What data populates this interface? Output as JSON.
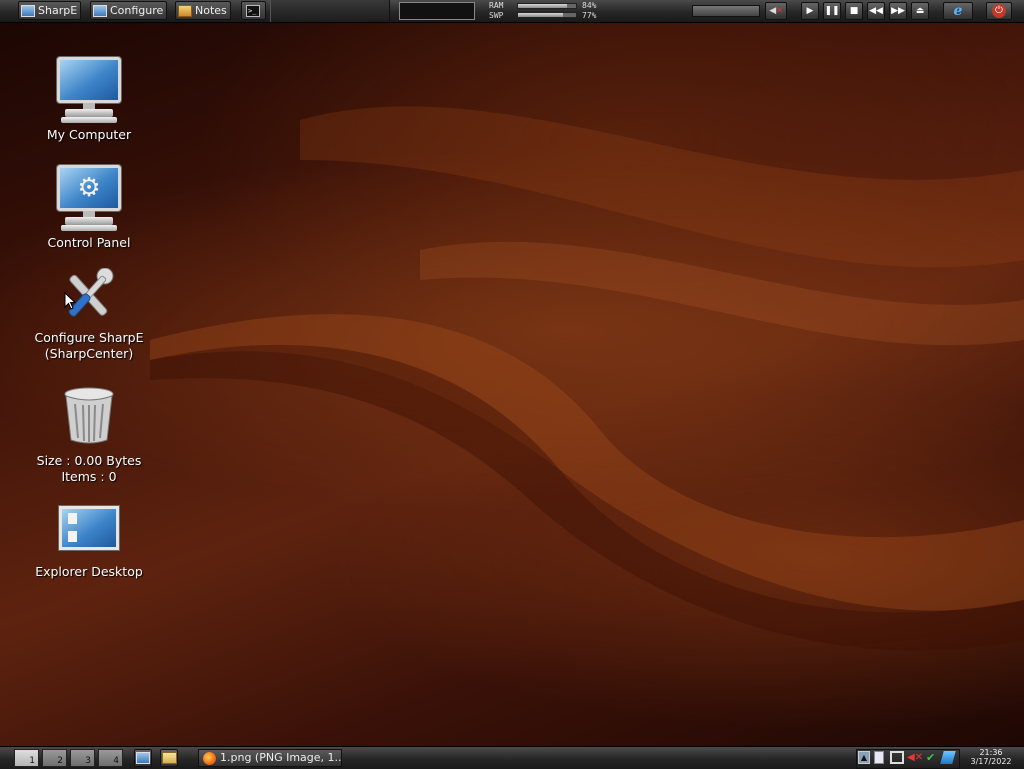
{
  "topbar": {
    "buttons": [
      {
        "label": "SharpE",
        "icon": "monitor-icon"
      },
      {
        "label": "Configure",
        "icon": "monitor-icon"
      },
      {
        "label": "Notes",
        "icon": "notes-icon"
      },
      {
        "label": "",
        "icon": "terminal-icon"
      }
    ],
    "meters": [
      {
        "label": "RAM",
        "percent_text": "84%",
        "value": 0.84
      },
      {
        "label": "SWP",
        "percent_text": "77%",
        "value": 0.77
      }
    ],
    "media_controls": [
      "play-icon",
      "pause-icon",
      "stop-icon",
      "previous-icon",
      "next-icon",
      "eject-icon"
    ],
    "volume_level": 0.5
  },
  "desktop": {
    "icons": [
      {
        "label": "My Computer",
        "icon": "computer-icon"
      },
      {
        "label": "Control Panel",
        "icon": "control-panel-icon"
      },
      {
        "label": "Configure SharpE\n(SharpCenter)",
        "icon": "tools-icon"
      },
      {
        "label": "Size : 0.00 Bytes\nItems : 0",
        "icon": "recycle-bin-icon"
      },
      {
        "label": "Explorer Desktop",
        "icon": "explorer-desktop-icon"
      }
    ]
  },
  "bottombar": {
    "workspaces": [
      "1",
      "2",
      "3",
      "4"
    ],
    "active_workspace": "1",
    "tasks": [
      {
        "label": "1.png (PNG Image, 1...",
        "icon": "firefox-icon"
      }
    ],
    "clock_time": "21:36",
    "clock_date": "3/17/2022"
  },
  "colors": {
    "accent": "#3d84c8",
    "power": "#c0392b"
  }
}
